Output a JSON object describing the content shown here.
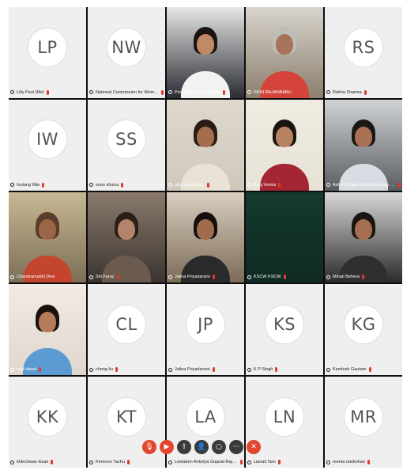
{
  "participants": [
    {
      "type": "avatar",
      "initials": "LP",
      "name": "Lilly Paul (Me)"
    },
    {
      "type": "avatar",
      "initials": "NW",
      "name": "National Commission for Women (Host)"
    },
    {
      "type": "video",
      "name": "Prof Dr Meenam Brnota",
      "active": true,
      "bg": "#2a2d33",
      "top": "#e6e6e6",
      "skin": "#c08a66",
      "hair": "#1b1411",
      "cloth": "#f2f2f2"
    },
    {
      "type": "video",
      "name": "RANI RAJANBABU",
      "bg": "#8c7f6e",
      "top": "#d8d4cd",
      "skin": "#a8735a",
      "hair": "#bfbdb8",
      "cloth": "#d5443a"
    },
    {
      "type": "avatar",
      "initials": "RS",
      "name": "Rekha Sharma"
    },
    {
      "type": "avatar",
      "initials": "IW",
      "name": "Ioolang War"
    },
    {
      "type": "avatar",
      "initials": "SS",
      "name": "sooo shuica"
    },
    {
      "type": "video",
      "name": "alpa choudhary",
      "bg": "#cfc8bc",
      "top": "#ded8cd",
      "skin": "#a46e4e",
      "hair": "#2a1c15",
      "cloth": "#e9e2d5"
    },
    {
      "type": "video",
      "name": "Anuj Verma",
      "bg": "#e7e2d6",
      "top": "#f0ece2",
      "skin": "#b78260",
      "hair": "#1a1410",
      "cloth": "#a42633"
    },
    {
      "type": "video",
      "name": "Ashok Chabe Joint Secretary NCW",
      "bg": "#5a5e63",
      "top": "#cfd3d6",
      "skin": "#a87153",
      "hair": "#1a1614",
      "cloth": "#d8dde3"
    },
    {
      "type": "video",
      "name": "Chandramukhi Devi",
      "bg": "#7c6e56",
      "top": "#c7b894",
      "skin": "#9a6646",
      "hair": "#5b3b2a",
      "cloth": "#c4452e"
    },
    {
      "type": "video",
      "name": "Shi Faraz",
      "bg": "#3b3430",
      "top": "#8a7b6c",
      "skin": "#b28469",
      "hair": "#2a1e19",
      "cloth": "#6b5a4e"
    },
    {
      "type": "video",
      "name": "Jalina Priyadarsini",
      "bg": "#7d6b58",
      "top": "#d9cfc0",
      "skin": "#a06c4d",
      "hair": "#140f0d",
      "cloth": "#2a2a2a"
    },
    {
      "type": "video",
      "name": "KSCW KSCW",
      "bg": "#0f2a22",
      "top": "#143a2e",
      "skin": "#0f2a22",
      "hair": "#0f2a22",
      "cloth": "#0f2a22",
      "blank": true
    },
    {
      "type": "video",
      "name": "Minati Behera",
      "bg": "#2b2b2b",
      "top": "#d8d8d8",
      "skin": "#a56e50",
      "hair": "#1a1412",
      "cloth": "#2f2f2f"
    },
    {
      "type": "video",
      "name": "rajul desai",
      "bg": "#e0d7ce",
      "top": "#f1ebe4",
      "skin": "#b67b5a",
      "hair": "#191210",
      "cloth": "#5b9bd1"
    },
    {
      "type": "avatar",
      "initials": "CL",
      "name": "chong liu"
    },
    {
      "type": "avatar",
      "initials": "JP",
      "name": "Jalina Priyadarsini"
    },
    {
      "type": "avatar",
      "initials": "KS",
      "name": "K P Singh"
    },
    {
      "type": "avatar",
      "initials": "KG",
      "name": "Kamlesh Gautam"
    },
    {
      "type": "avatar",
      "initials": "KK",
      "name": "khlechwan kisan"
    },
    {
      "type": "avatar",
      "initials": "KT",
      "name": "Khrieruo Tachu"
    },
    {
      "type": "avatar",
      "initials": "LA",
      "name": "Leelaben Ankolya Gujarat Rajya Mahila Ay"
    },
    {
      "type": "avatar",
      "initials": "LN",
      "name": "Lianah Nzo"
    },
    {
      "type": "avatar",
      "initials": "MR",
      "name": "meeta raiokohan"
    }
  ],
  "controls": [
    {
      "name": "mic-button",
      "glyph": "🎙",
      "color": "#e2462f"
    },
    {
      "name": "video-button",
      "glyph": "▶",
      "color": "#e2462f"
    },
    {
      "name": "share-button",
      "glyph": "⇧",
      "color": "#3a3a3a"
    },
    {
      "name": "participants-button",
      "glyph": "👤",
      "color": "#3a3a3a"
    },
    {
      "name": "chat-button",
      "glyph": "○",
      "color": "#3a3a3a"
    },
    {
      "name": "more-button",
      "glyph": "···",
      "color": "#3a3a3a"
    },
    {
      "name": "leave-button",
      "glyph": "✕",
      "color": "#e2462f"
    }
  ]
}
